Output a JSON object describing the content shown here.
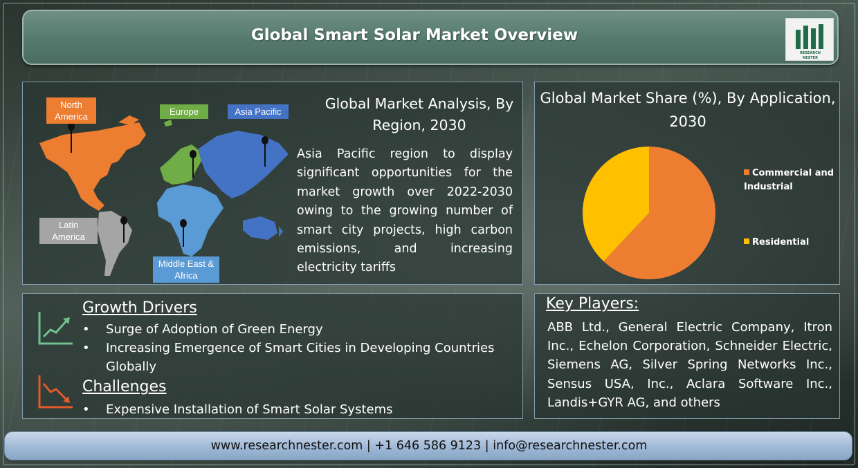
{
  "header": {
    "title": "Global Smart Solar Market Overview",
    "logo_text_1": "RESEARCH",
    "logo_text_2": "NESTER"
  },
  "region_panel": {
    "title": "Global Market Analysis, By Region, 2030",
    "description": "Asia Pacific region to display significant opportunities for the market growth over 2022-2030 owing to the growing number of smart city projects, high carbon emissions, and increasing electricity tariffs",
    "map_labels": {
      "north_america": "North America",
      "europe": "Europe",
      "asia_pacific": "Asia Pacific",
      "latin_america": "Latin America",
      "middle_east_africa": "Middle East & Africa"
    },
    "map_colors": {
      "north_america": "#ed7d31",
      "europe": "#70ad47",
      "asia_pacific": "#4472c4",
      "latin_america": "#a5a5a5",
      "middle_east_africa": "#5b9bd5"
    }
  },
  "share_panel": {
    "title": "Global Market Share (%), By Application, 2030",
    "chart_data": {
      "type": "pie",
      "categories": [
        "Commercial and Industrial",
        "Residential"
      ],
      "values": [
        62,
        38
      ],
      "colors": [
        "#ed7d31",
        "#ffc000"
      ],
      "legend_placement": "right"
    }
  },
  "drivers": {
    "growth_heading": "Growth Drivers",
    "growth_items": [
      "Surge of Adoption of Green Energy",
      "Increasing Emergence of Smart Cities in Developing Countries Globally"
    ],
    "challenges_heading": "Challenges",
    "challenge_items": [
      "Expensive Installation of Smart Solar Systems"
    ]
  },
  "players": {
    "heading": "Key Players:",
    "text": "ABB Ltd., General Electric Company, Itron Inc., Echelon Corporation, Schneider Electric, Siemens AG, Silver Spring Networks Inc., Sensus USA, Inc., Aclara Software Inc., Landis+GYR AG, and others"
  },
  "footer": {
    "contact": "www.researchnester.com | +1 646 586 9123 | info@researchnester.com"
  }
}
